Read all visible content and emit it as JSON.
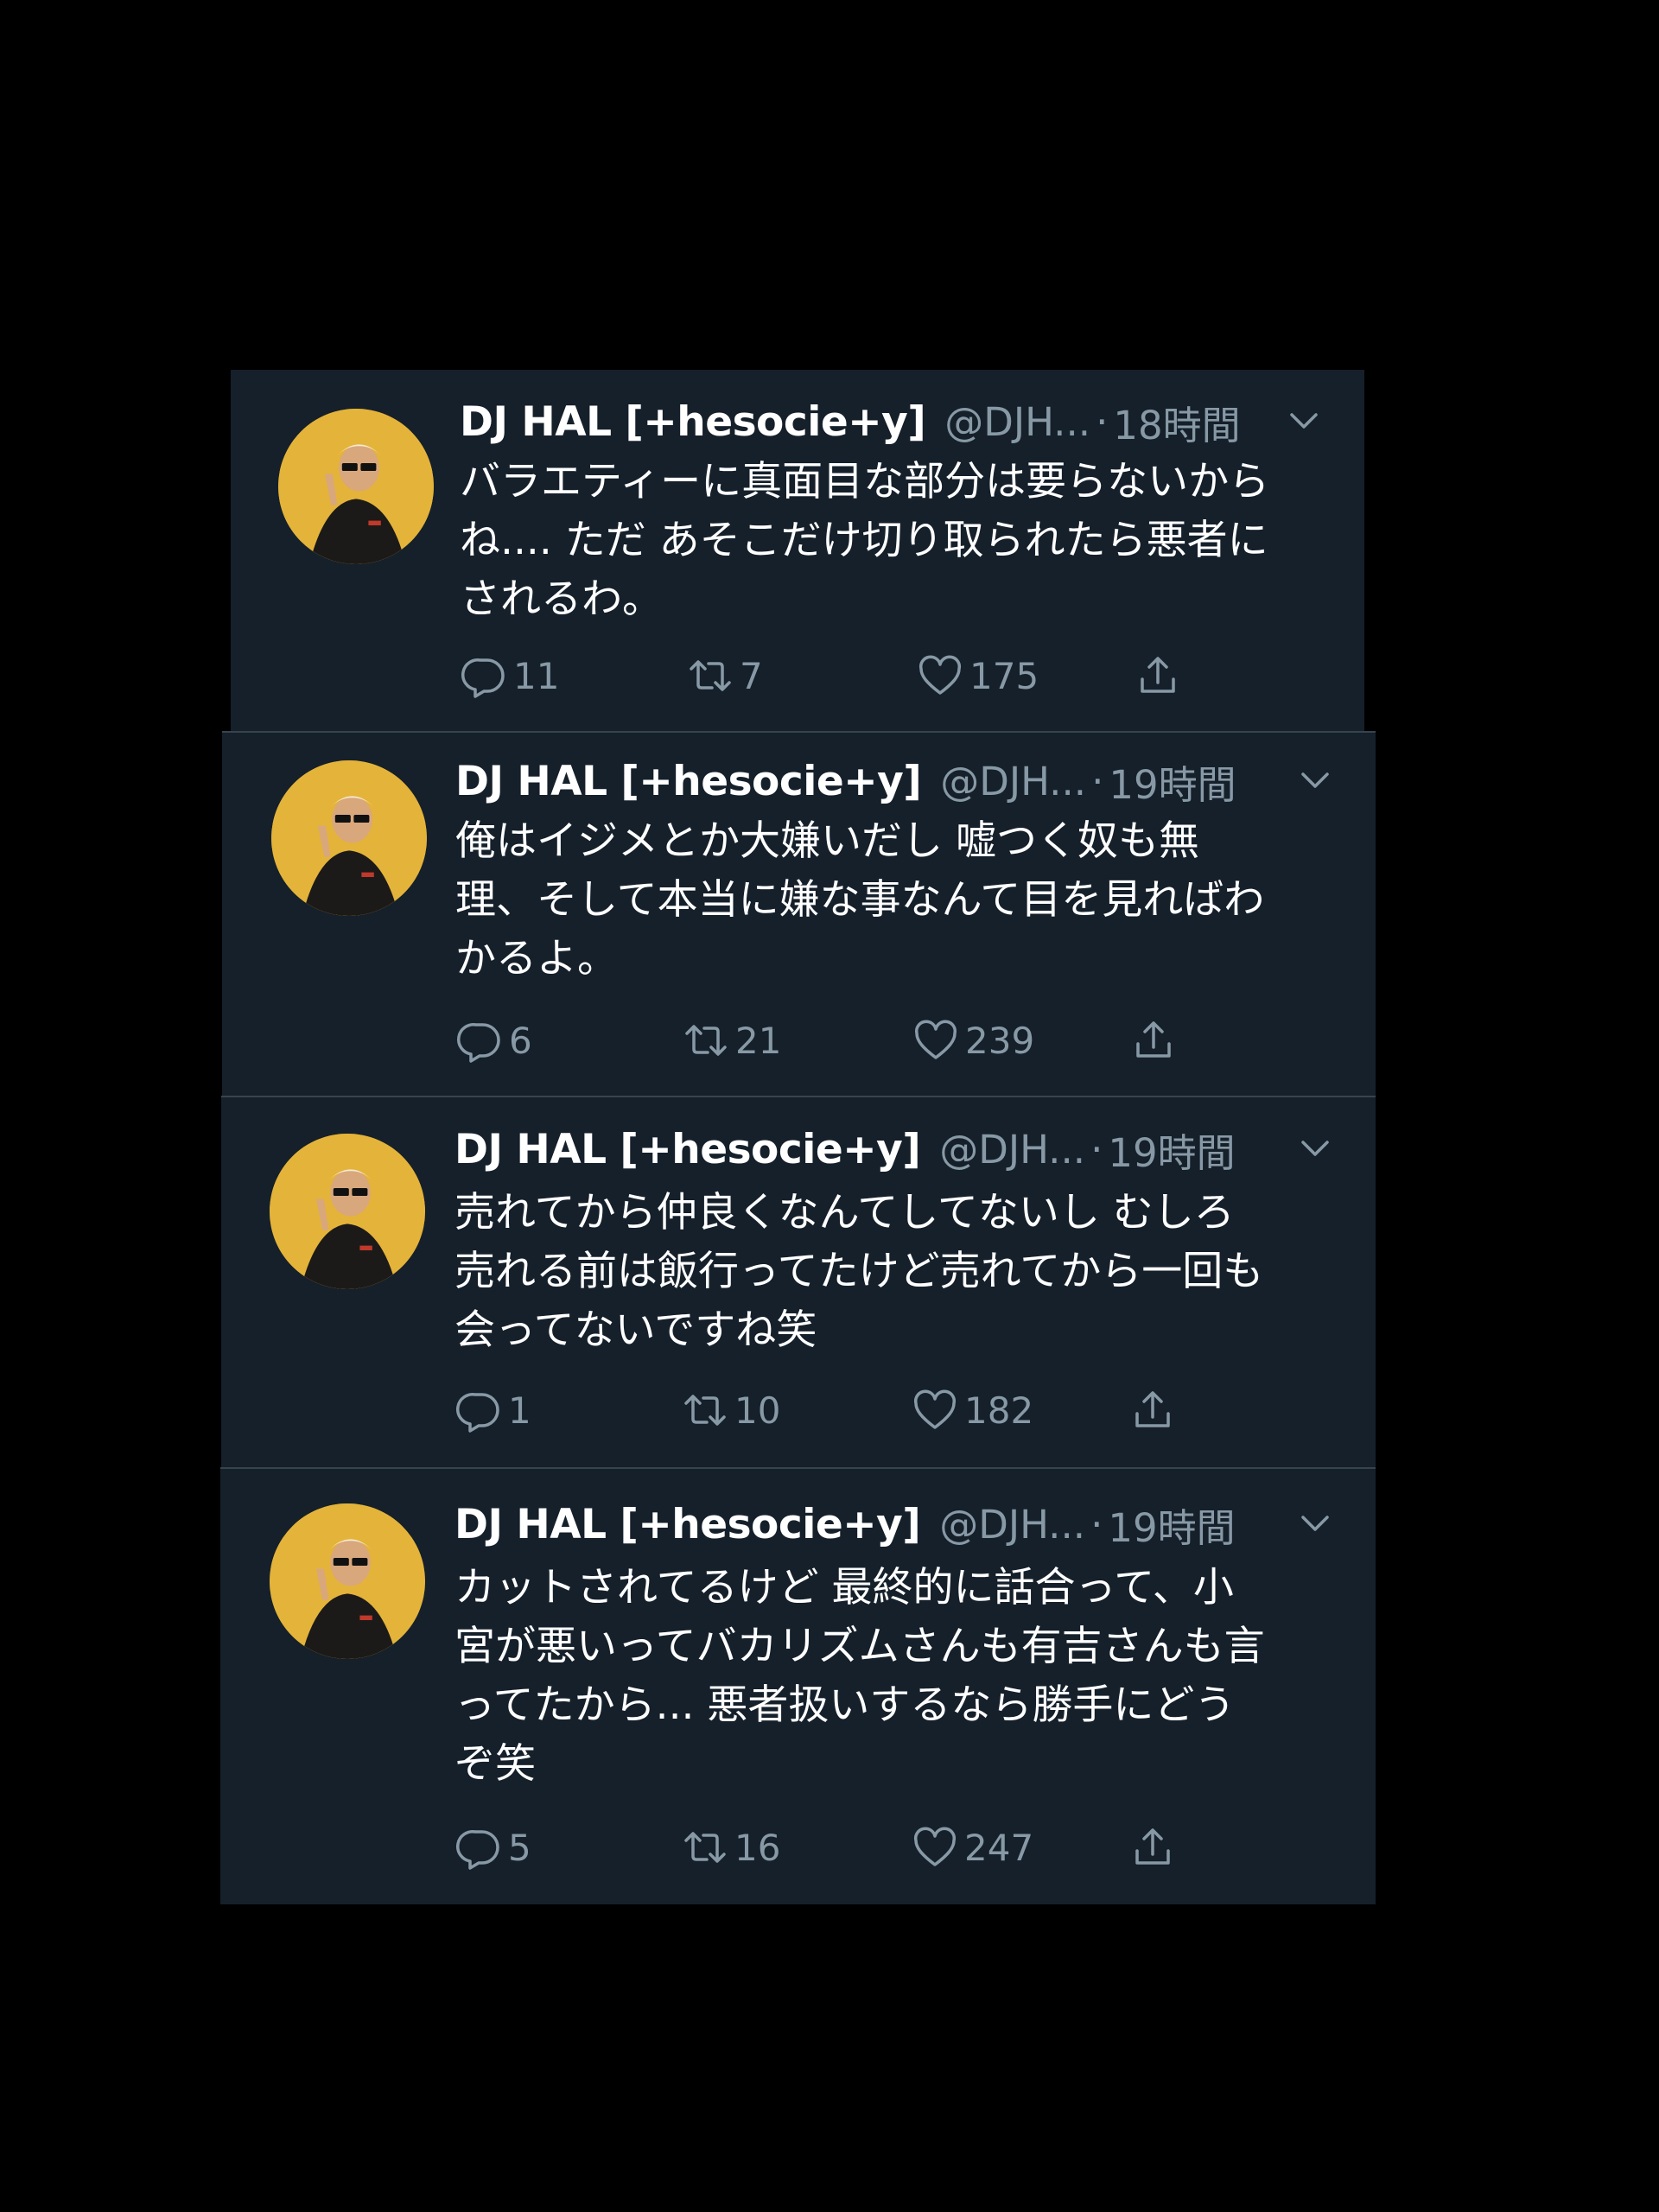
{
  "colors": {
    "background": "#000000",
    "card": "#15202b",
    "text": "#ffffff",
    "secondary": "#8899a6",
    "divider": "#38444d"
  },
  "tweets": [
    {
      "name": "DJ HAL [+hesocie+y]",
      "handle": "@DJH...",
      "separator": "·",
      "time": "18時間",
      "text": "バラエティーに真面目な部分は要らないから\nね.... ただ あそこだけ切り取られたら悪者に\nされるわ。",
      "replies": "11",
      "retweets": "7",
      "likes": "175"
    },
    {
      "name": "DJ HAL [+hesocie+y]",
      "handle": "@DJH...",
      "separator": "·",
      "time": "19時間",
      "text": "俺はイジメとか大嫌いだし 嘘つく奴も無\n理、そして本当に嫌な事なんて目を見ればわ\nかるよ。",
      "replies": "6",
      "retweets": "21",
      "likes": "239"
    },
    {
      "name": "DJ HAL [+hesocie+y]",
      "handle": "@DJH...",
      "separator": "·",
      "time": "19時間",
      "text": "売れてから仲良くなんてしてないし むしろ\n売れる前は飯行ってたけど売れてから一回も\n会ってないですね笑",
      "replies": "1",
      "retweets": "10",
      "likes": "182"
    },
    {
      "name": "DJ HAL [+hesocie+y]",
      "handle": "@DJH...",
      "separator": "·",
      "time": "19時間",
      "text": "カットされてるけど 最終的に話合って、小\n宮が悪いってバカリズムさんも有吉さんも言\nってたから... 悪者扱いするなら勝手にどう\nぞ笑",
      "replies": "5",
      "retweets": "16",
      "likes": "247"
    }
  ]
}
